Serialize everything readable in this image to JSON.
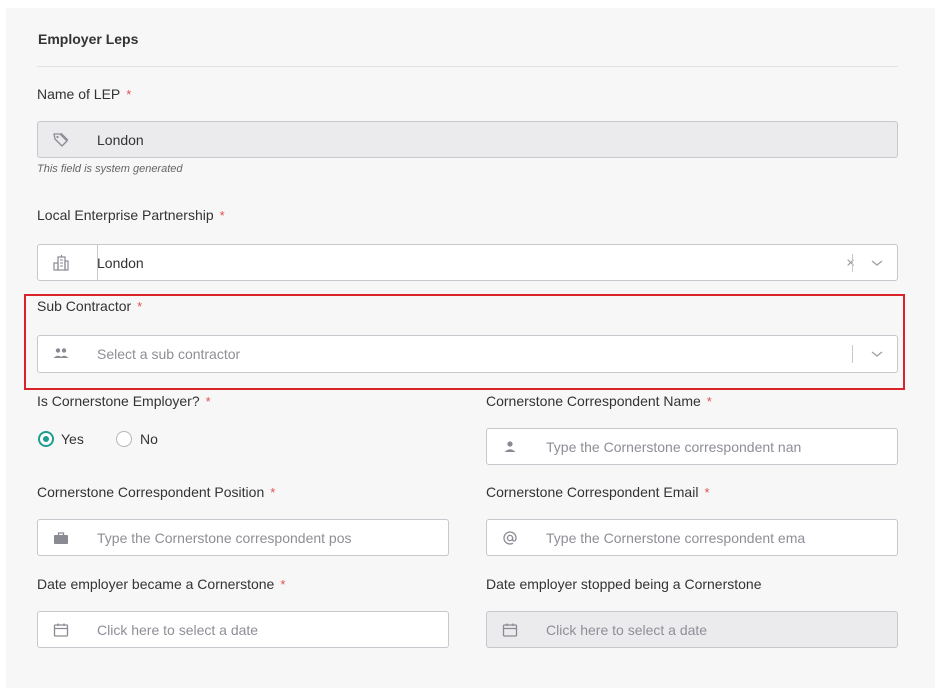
{
  "section": {
    "title": "Employer Leps"
  },
  "name_of_lep": {
    "label": "Name of LEP",
    "required_mark": "*",
    "value": "London",
    "icon": "tag-icon",
    "hint": "This field is system generated"
  },
  "local_enterprise_partnership": {
    "label": "Local Enterprise Partnership",
    "required_mark": "*",
    "value": "London",
    "icon": "building-icon",
    "clear_glyph": "×"
  },
  "sub_contractor": {
    "label": "Sub Contractor",
    "required_mark": "*",
    "placeholder": "Select a sub contractor",
    "icon": "users-icon"
  },
  "is_cornerstone_employer": {
    "label": "Is Cornerstone Employer?",
    "required_mark": "*",
    "options": [
      {
        "label": "Yes",
        "selected": true
      },
      {
        "label": "No",
        "selected": false
      }
    ]
  },
  "correspondent_name": {
    "label": "Cornerstone Correspondent Name",
    "required_mark": "*",
    "placeholder": "Type the Cornerstone correspondent nan",
    "icon": "user-icon"
  },
  "correspondent_position": {
    "label": "Cornerstone Correspondent Position",
    "required_mark": "*",
    "placeholder": "Type the Cornerstone correspondent pos",
    "icon": "briefcase-icon"
  },
  "correspondent_email": {
    "label": "Cornerstone Correspondent Email",
    "required_mark": "*",
    "placeholder": "Type the Cornerstone correspondent ema",
    "icon": "at-icon"
  },
  "date_became": {
    "label": "Date employer became a Cornerstone",
    "required_mark": "*",
    "placeholder": "Click here to select a date",
    "icon": "calendar-icon"
  },
  "date_stopped": {
    "label": "Date employer stopped being a Cornerstone",
    "placeholder": "Click here to select a date",
    "icon": "calendar-icon"
  },
  "colors": {
    "highlight": "#d9232b",
    "required": "#e0524f",
    "radio_accent": "#1f9e8f"
  }
}
